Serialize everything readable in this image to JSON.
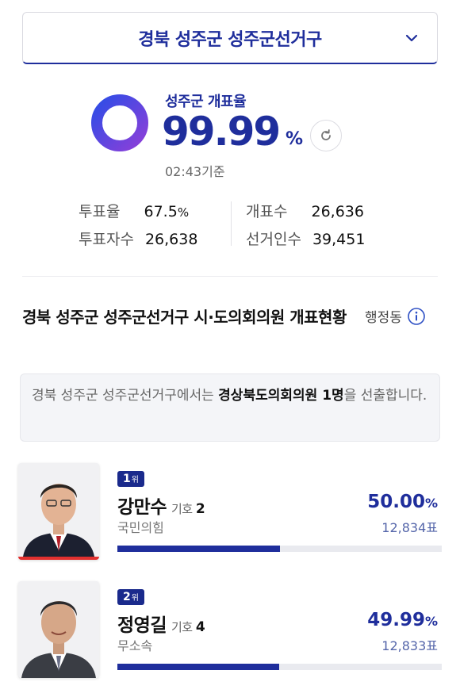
{
  "header": {
    "district": "경북 성주군 성주군선거구"
  },
  "counting": {
    "title": "성주군 개표율",
    "rate": "99.99",
    "rate_unit": "%",
    "rate_fraction": 0.9999,
    "time": "02:43기준"
  },
  "stats": {
    "turnout_label": "투표율",
    "turnout_value": "67.5",
    "turnout_unit": "%",
    "voters_label": "투표자수",
    "voters_value": "26,638",
    "counted_label": "개표수",
    "counted_value": "26,636",
    "electorate_label": "선거인수",
    "electorate_value": "39,451"
  },
  "section": {
    "title": "경북 성주군 성주군선거구 시·도의회의원 개표현황",
    "filter_label": "행정동",
    "notice_prefix": "경북 성주군 성주군선거구에서는 ",
    "notice_bold": "경상북도의회의원 1명",
    "notice_suffix": "을 선출합니다."
  },
  "candidates": [
    {
      "rank": "1",
      "rank_suffix": "위",
      "name": "강만수",
      "ballot_label": "기호",
      "ballot_no": "2",
      "party": "국민의힘",
      "pct": "50.00",
      "pct_unit": "%",
      "votes": "12,834표",
      "share": 0.5
    },
    {
      "rank": "2",
      "rank_suffix": "위",
      "name": "정영길",
      "ballot_label": "기호",
      "ballot_no": "4",
      "party": "무소속",
      "pct": "49.99",
      "pct_unit": "%",
      "votes": "12,833표",
      "share": 0.4999
    }
  ],
  "colors": {
    "accent": "#1f2e9c",
    "ring_start": "#3b3fe0",
    "ring_end": "#8a3fd8",
    "winner_mark": "#e2302f"
  }
}
